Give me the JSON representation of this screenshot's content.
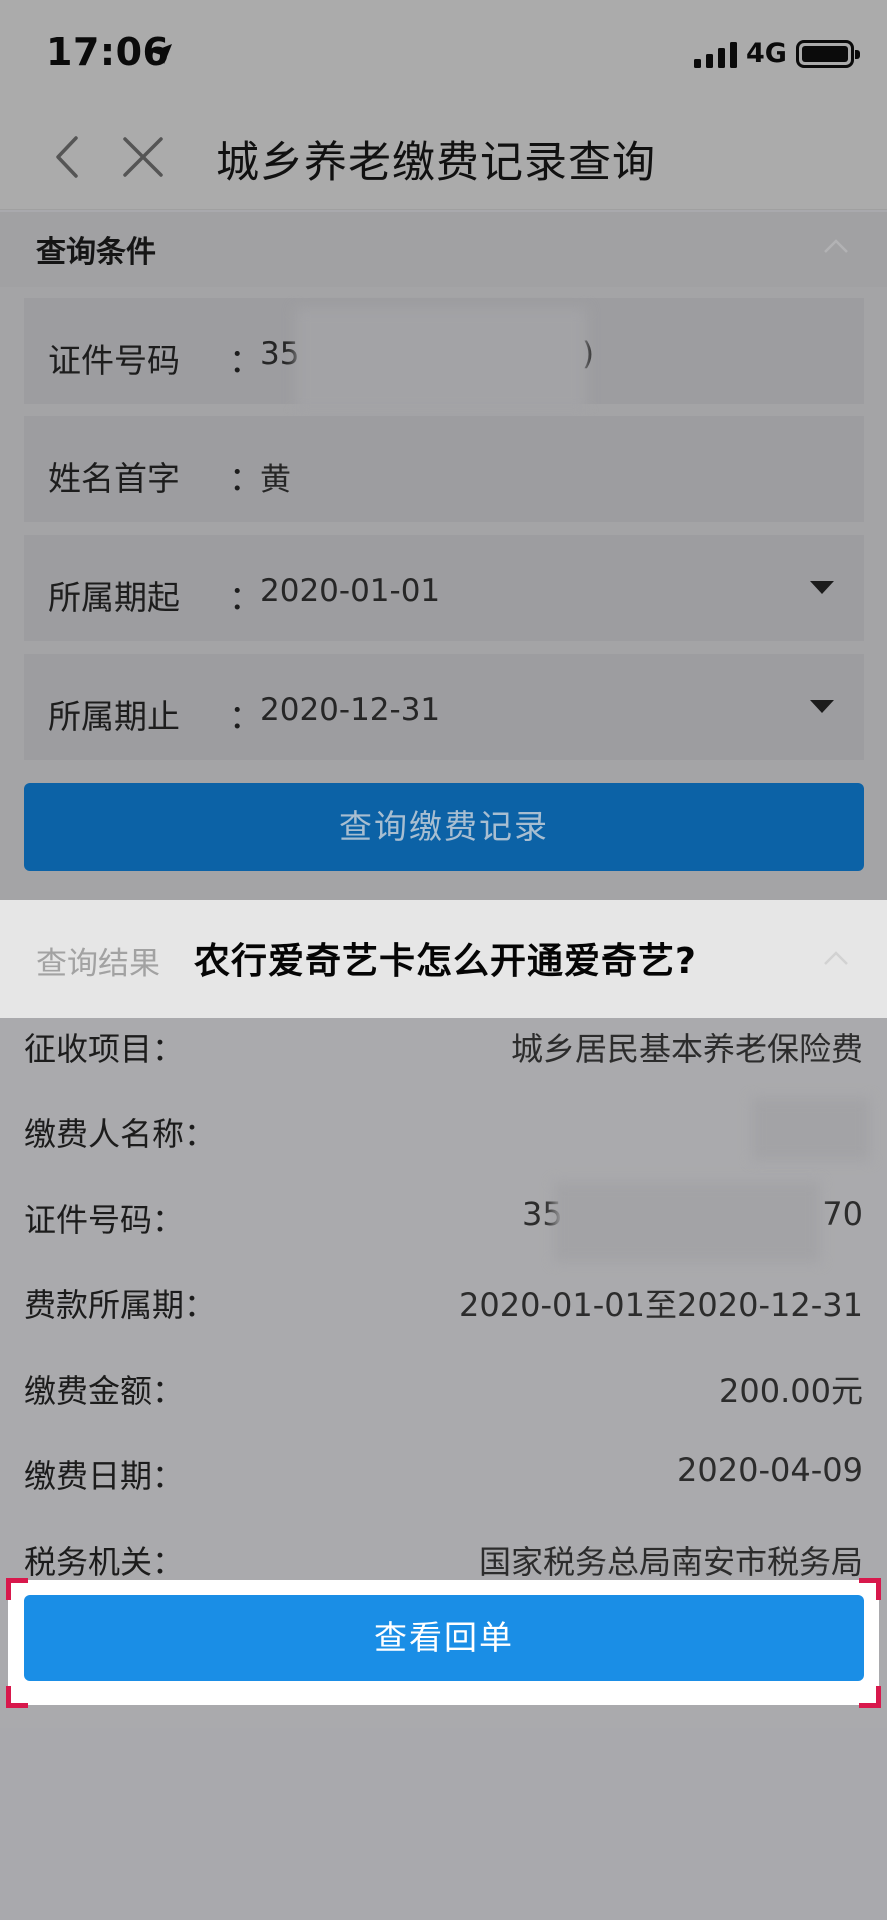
{
  "status_bar": {
    "time": "17:06",
    "network": "4G"
  },
  "nav": {
    "title": "城乡养老缴费记录查询"
  },
  "query_section": {
    "title": "查询条件",
    "colon": "：",
    "fields": [
      {
        "label": "证件号码",
        "value": "35",
        "value_tail": ")"
      },
      {
        "label": "姓名首字",
        "value": "黄"
      },
      {
        "label": "所属期起",
        "value": "2020-01-01"
      },
      {
        "label": "所属期止",
        "value": "2020-12-31"
      }
    ],
    "button_label": "查询缴费记录"
  },
  "banner": {
    "section_title": "查询结果",
    "caption": "农行爱奇艺卡怎么开通爱奇艺?"
  },
  "results": {
    "rows": [
      {
        "label": "征收项目：",
        "value": "城乡居民基本养老保险费"
      },
      {
        "label": "缴费人名称：",
        "value": ""
      },
      {
        "label": "证件号码：",
        "value": "35",
        "value_tail": "70"
      },
      {
        "label": "费款所属期：",
        "value": "2020-01-01至2020-12-31"
      },
      {
        "label": "缴费金额：",
        "value": "200.00元"
      },
      {
        "label": "缴费日期：",
        "value": "2020-04-09"
      },
      {
        "label": "税务机关：",
        "value": "国家税务总局南安市税务局"
      }
    ],
    "receipt_button_label": "查看回单"
  },
  "colors": {
    "query_button": "#0c62a6",
    "receipt_button": "#1a8ee6",
    "highlight_corner": "#d8184c"
  }
}
